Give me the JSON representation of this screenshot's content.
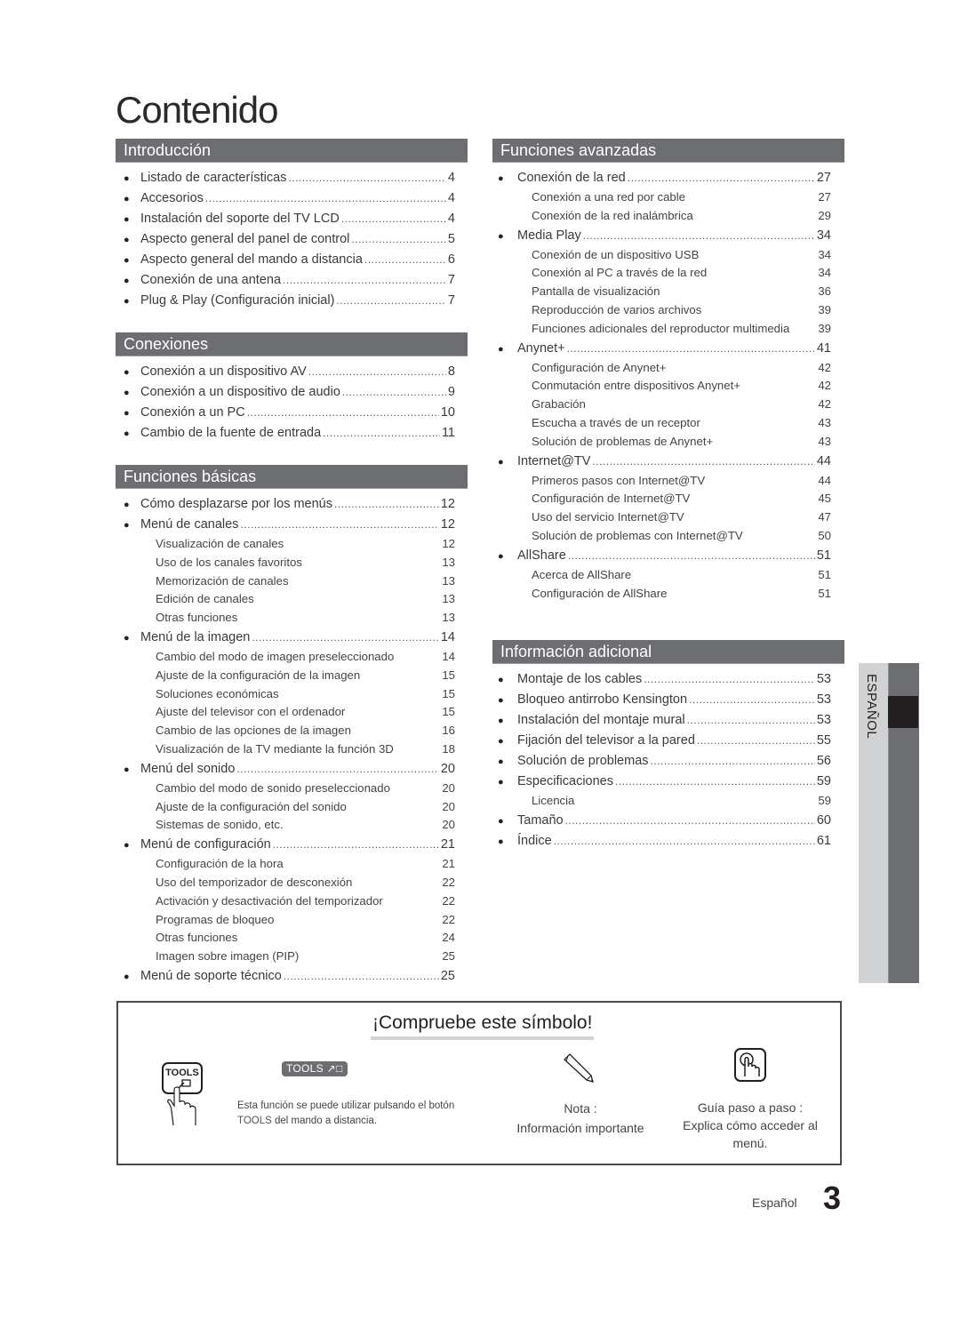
{
  "page": {
    "title": "Contenido",
    "footer_language": "Español",
    "page_number": "3",
    "side_tab_language": "ESPAÑOL"
  },
  "colors": {
    "section_header_bg": "#6d6e71",
    "side_tab_light": "#d1d2d4",
    "side_tab_dark": "#6d6e71",
    "side_tab_marker": "#231f20"
  },
  "left_column": {
    "introduccion": {
      "title": "Introducción",
      "items": [
        {
          "label": "Listado de características",
          "page": "4"
        },
        {
          "label": "Accesorios",
          "page": "4"
        },
        {
          "label": "Instalación del soporte del TV LCD",
          "page": "4"
        },
        {
          "label": "Aspecto general del panel de control",
          "page": "5"
        },
        {
          "label": "Aspecto general del mando a distancia",
          "page": "6"
        },
        {
          "label": "Conexión de una antena",
          "page": "7"
        },
        {
          "label": "Plug & Play (Configuración inicial)",
          "page": "7"
        }
      ]
    },
    "conexiones": {
      "title": "Conexiones",
      "items": [
        {
          "label": "Conexión a un dispositivo AV",
          "page": "8"
        },
        {
          "label": "Conexión a un dispositivo de audio",
          "page": "9"
        },
        {
          "label": "Conexión a un PC",
          "page": "10"
        },
        {
          "label": "Cambio de la fuente de entrada",
          "page": "11"
        }
      ]
    },
    "funciones_basicas": {
      "title": "Funciones básicas",
      "items": [
        {
          "label": "Cómo desplazarse por los menús",
          "page": "12",
          "level": 1
        },
        {
          "label": "Menú de canales",
          "page": "12",
          "level": 1
        },
        {
          "label": "Visualización de canales",
          "page": "12",
          "level": 2
        },
        {
          "label": "Uso de los canales favoritos",
          "page": "13",
          "level": 2
        },
        {
          "label": "Memorización de canales",
          "page": "13",
          "level": 2
        },
        {
          "label": "Edición de canales",
          "page": "13",
          "level": 2
        },
        {
          "label": "Otras funciones",
          "page": "13",
          "level": 2
        },
        {
          "label": "Menú de la imagen",
          "page": "14",
          "level": 1
        },
        {
          "label": "Cambio del modo de imagen preseleccionado",
          "page": "14",
          "level": 2
        },
        {
          "label": "Ajuste de la configuración de la imagen",
          "page": "15",
          "level": 2
        },
        {
          "label": "Soluciones económicas",
          "page": "15",
          "level": 2
        },
        {
          "label": "Ajuste del televisor con el ordenador",
          "page": "15",
          "level": 2
        },
        {
          "label": "Cambio de las opciones de la imagen",
          "page": "16",
          "level": 2
        },
        {
          "label": "Visualización de la TV mediante la función 3D",
          "page": "18",
          "level": 2
        },
        {
          "label": "Menú del sonido",
          "page": "20",
          "level": 1
        },
        {
          "label": "Cambio del modo de sonido preseleccionado",
          "page": "20",
          "level": 2
        },
        {
          "label": "Ajuste de la configuración del sonido",
          "page": "20",
          "level": 2
        },
        {
          "label": "Sistemas de sonido, etc.",
          "page": "20",
          "level": 2
        },
        {
          "label": "Menú de configuración",
          "page": "21",
          "level": 1
        },
        {
          "label": "Configuración de la hora",
          "page": "21",
          "level": 2
        },
        {
          "label": "Uso del temporizador de desconexión",
          "page": "22",
          "level": 2
        },
        {
          "label": "Activación y desactivación del temporizador",
          "page": "22",
          "level": 2
        },
        {
          "label": "Programas de bloqueo",
          "page": "22",
          "level": 2
        },
        {
          "label": "Otras funciones",
          "page": "24",
          "level": 2
        },
        {
          "label": "Imagen sobre imagen (PIP)",
          "page": "25",
          "level": 2
        },
        {
          "label": "Menú de soporte técnico",
          "page": "25",
          "level": 1
        }
      ]
    }
  },
  "right_column": {
    "funciones_avanzadas": {
      "title": "Funciones avanzadas",
      "items": [
        {
          "label": "Conexión de la red",
          "page": "27",
          "level": 1
        },
        {
          "label": "Conexión a una red por cable",
          "page": "27",
          "level": 2
        },
        {
          "label": "Conexión de la red inalámbrica",
          "page": "29",
          "level": 2
        },
        {
          "label": "Media Play",
          "page": "34",
          "level": 1
        },
        {
          "label": "Conexión de un dispositivo USB",
          "page": "34",
          "level": 2
        },
        {
          "label": "Conexión al PC a través de la red",
          "page": "34",
          "level": 2
        },
        {
          "label": "Pantalla de visualización",
          "page": "36",
          "level": 2
        },
        {
          "label": "Reproducción de varios archivos",
          "page": "39",
          "level": 2
        },
        {
          "label": "Funciones adicionales del reproductor multimedia",
          "page": "39",
          "level": 2
        },
        {
          "label": "Anynet+",
          "page": "41",
          "level": 1
        },
        {
          "label": "Configuración de Anynet+",
          "page": "42",
          "level": 2
        },
        {
          "label": "Conmutación entre dispositivos Anynet+",
          "page": "42",
          "level": 2
        },
        {
          "label": "Grabación",
          "page": "42",
          "level": 2
        },
        {
          "label": "Escucha a través de un receptor",
          "page": "43",
          "level": 2
        },
        {
          "label": "Solución de problemas de Anynet+",
          "page": "43",
          "level": 2
        },
        {
          "label": "Internet@TV",
          "page": "44",
          "level": 1
        },
        {
          "label": "Primeros pasos con Internet@TV",
          "page": "44",
          "level": 2
        },
        {
          "label": "Configuración de Internet@TV",
          "page": "45",
          "level": 2
        },
        {
          "label": "Uso del servicio Internet@TV",
          "page": "47",
          "level": 2
        },
        {
          "label": "Solución de problemas con Internet@TV",
          "page": "50",
          "level": 2
        },
        {
          "label": "AllShare",
          "page": "51",
          "level": 1
        },
        {
          "label": "Acerca de AllShare",
          "page": "51",
          "level": 2
        },
        {
          "label": "Configuración de AllShare",
          "page": "51",
          "level": 2
        }
      ]
    },
    "informacion_adicional": {
      "title": "Información adicional",
      "items": [
        {
          "label": "Montaje de los cables",
          "page": "53",
          "level": 1
        },
        {
          "label": "Bloqueo antirrobo Kensington",
          "page": "53",
          "level": 1
        },
        {
          "label": "Instalación del montaje mural",
          "page": "53",
          "level": 1
        },
        {
          "label": "Fijación del televisor a la pared",
          "page": "55",
          "level": 1
        },
        {
          "label": "Solución de problemas",
          "page": "56",
          "level": 1
        },
        {
          "label": "Especificaciones",
          "page": "59",
          "level": 1
        },
        {
          "label": "Licencia",
          "page": "59",
          "level": 2
        },
        {
          "label": "Tamaño",
          "page": "60",
          "level": 1
        },
        {
          "label": "Índice",
          "page": "61",
          "level": 1
        }
      ]
    }
  },
  "symbol_box": {
    "title": "¡Compruebe este símbolo!",
    "tools": {
      "icon": "tools-button-hand-icon",
      "badge_label": "TOOLS",
      "badge_icon": "tools-arrow-icon",
      "button_label": "TOOLS",
      "description_line1": "Esta función se puede utilizar pulsando el botón",
      "description_tools_word": "TOOLS",
      "description_line2_rest": " del mando a distancia."
    },
    "note": {
      "icon": "pencil-icon",
      "label": "Nota :",
      "description": "Información importante"
    },
    "guide": {
      "icon": "pointing-hand-icon",
      "label": "Guía paso a paso :",
      "description_line1": "Explica cómo acceder al",
      "description_line2": "menú."
    }
  }
}
